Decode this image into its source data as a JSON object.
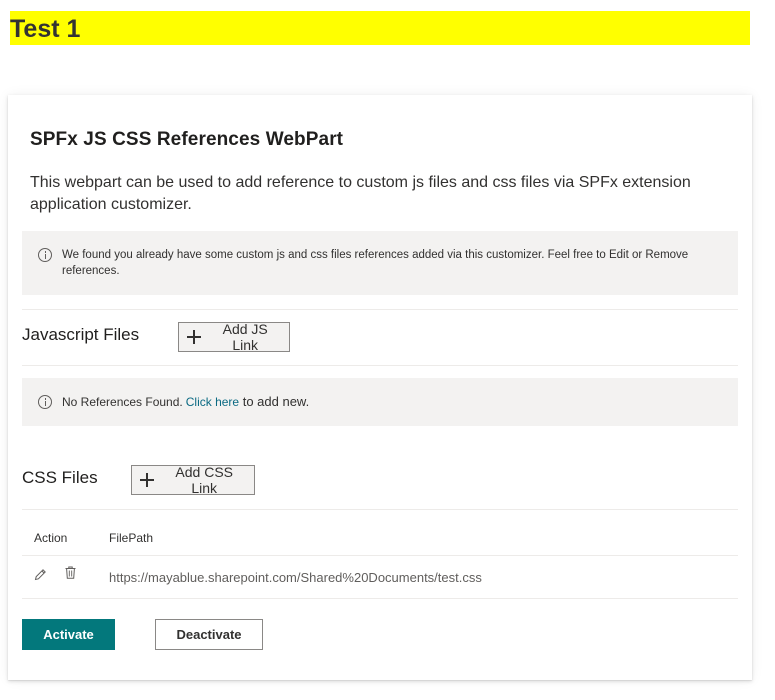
{
  "page": {
    "title": "Test 1"
  },
  "webpart": {
    "title": "SPFx JS CSS References WebPart",
    "description": "This webpart can be used to add reference to custom js files and css files via SPFx extension application customizer.",
    "existing_message": "We found you already have some custom js and css files references added via this customizer. Feel free to Edit or Remove references."
  },
  "js_section": {
    "label": "Javascript Files",
    "add_button": "Add JS Link",
    "empty_message": {
      "prefix": "No References Found. ",
      "link": "Click here",
      "suffix": " to add new."
    }
  },
  "css_section": {
    "label": "CSS Files",
    "add_button": "Add CSS Link",
    "table": {
      "headers": [
        "Action",
        "FilePath"
      ],
      "rows": [
        {
          "filepath": "https://mayablue.sharepoint.com/Shared%20Documents/test.css",
          "actions": [
            "edit-icon",
            "delete-icon"
          ]
        }
      ]
    }
  },
  "footer": {
    "activate": "Activate",
    "deactivate": "Deactivate"
  },
  "colors": {
    "title_highlight": "#ffff00",
    "primary": "#03787c",
    "link": "#0b6a83",
    "message_bg": "#f3f2f1"
  }
}
